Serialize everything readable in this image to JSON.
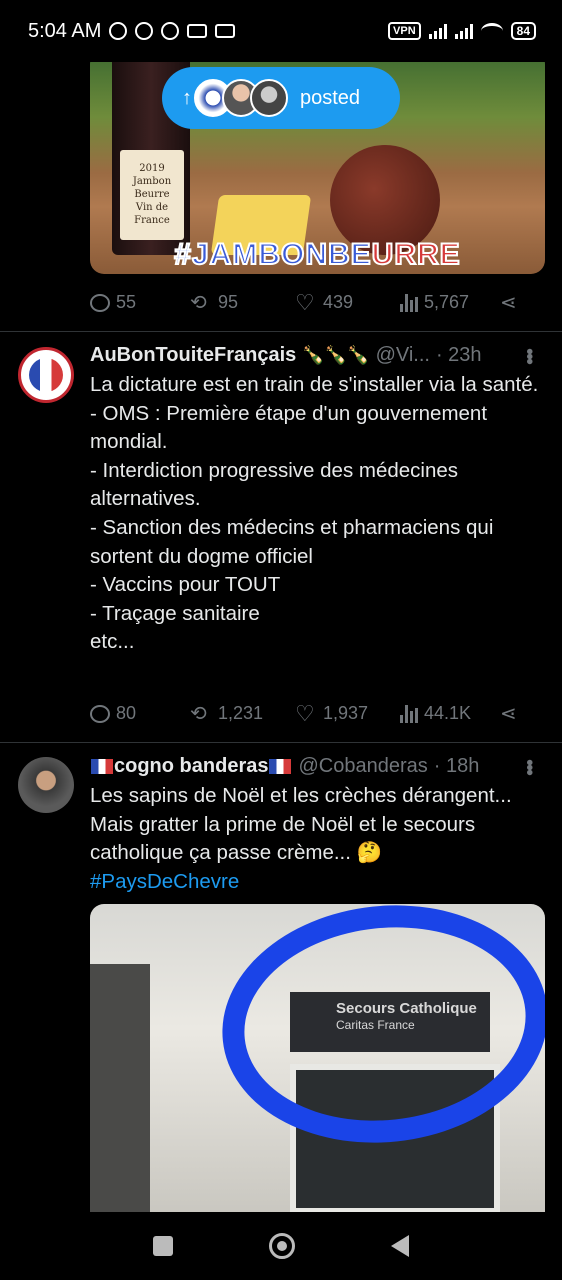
{
  "status_bar": {
    "time": "5:04 AM",
    "vpn_label": "VPN",
    "battery": "84"
  },
  "first_post": {
    "image_hashtag_part1": "#JAMBONBE",
    "image_hashtag_part2": "URRE",
    "bottle_label": "2019\nJambon\nBeurre\nVin de France",
    "posted_pill_label": "posted",
    "stats": {
      "replies": "55",
      "reposts": "95",
      "likes": "439",
      "views": "5,767"
    }
  },
  "tweet2": {
    "display_name": "AuBonTouiteFrançais",
    "name_emoji": "🍾🍾🍾",
    "handle": "@Vi...",
    "time": "· 23h",
    "body": "La dictature est en train de s'installer via la santé.\n- OMS : Première étape d'un gouvernement mondial.\n- Interdiction progressive des médecines alternatives.\n- Sanction des médecins et pharmaciens qui sortent du dogme officiel\n- Vaccins pour TOUT\n- Traçage sanitaire\netc...",
    "stats": {
      "replies": "80",
      "reposts": "1,231",
      "likes": "1,937",
      "views": "44.1K"
    }
  },
  "tweet3": {
    "display_name": "cogno banderas",
    "handle": "@Cobanderas",
    "time": "· 18h",
    "body": "Les sapins de Noël et les crèches dérangent...\nMais gratter la prime de Noël et le secours catholique ça passe crème... 🤔",
    "hashtag": "#PaysDeChevre",
    "image_sign_title": "Secours Catholique",
    "image_sign_sub": "Caritas France"
  },
  "icons": {
    "reply": "reply-icon",
    "repost": "repost-icon",
    "like": "heart-icon",
    "views": "views-icon",
    "share": "share-icon"
  },
  "colors": {
    "accent": "#1d9bf0",
    "muted": "#71767b",
    "text": "#e7e9ea",
    "divider": "#2f3336"
  }
}
